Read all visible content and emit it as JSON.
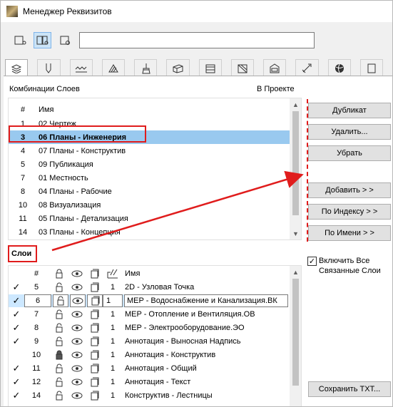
{
  "window": {
    "title": "Менеджер Реквизитов"
  },
  "toolbar": {
    "search_value": ""
  },
  "tabs": [
    {
      "icon": "layers-icon",
      "active": true
    },
    {
      "icon": "pen-icon"
    },
    {
      "icon": "line-type-icon"
    },
    {
      "icon": "fill-icon"
    },
    {
      "icon": "brush-icon"
    },
    {
      "icon": "building-material-icon"
    },
    {
      "icon": "composite-icon"
    },
    {
      "icon": "profile-icon"
    },
    {
      "icon": "zone-category-icon"
    },
    {
      "icon": "mep-icon"
    },
    {
      "icon": "globe-icon"
    },
    {
      "icon": "more-icon"
    }
  ],
  "combinations": {
    "header": "Комбинации Слоев",
    "in_project": "В Проекте",
    "col_num": "#",
    "col_name": "Имя",
    "rows": [
      {
        "num": "1",
        "name": "02 Чертеж"
      },
      {
        "num": "3",
        "name": "06 Планы - Инженерия",
        "selected": true
      },
      {
        "num": "4",
        "name": "07 Планы - Конструктив"
      },
      {
        "num": "5",
        "name": "09 Публикация"
      },
      {
        "num": "7",
        "name": "01 Местность"
      },
      {
        "num": "8",
        "name": "04 Планы - Рабочие"
      },
      {
        "num": "10",
        "name": "08 Визуализация"
      },
      {
        "num": "11",
        "name": "05 Планы - Детализация"
      },
      {
        "num": "14",
        "name": "03 Планы - Концепция"
      }
    ]
  },
  "buttons": {
    "duplicate": "Дубликат",
    "delete": "Удалить...",
    "remove": "Убрать",
    "add": "Добавить > >",
    "by_index": "По Индексу > >",
    "by_name": "По Имени > >",
    "save_txt": "Сохранить TXT..."
  },
  "layers": {
    "header": "Слои",
    "col_num": "#",
    "col_name": "Имя",
    "include_linked": "Включить Все Связанные Слои",
    "include_linked_checked": true,
    "rows": [
      {
        "check": "✓",
        "num": "5",
        "pen": "1",
        "name": "2D - Узловая Точка"
      },
      {
        "check": "✓",
        "num": "6",
        "pen": "1",
        "name": "MEP - Водоснабжение и Канализация.ВК",
        "selected": true
      },
      {
        "check": "✓",
        "num": "7",
        "pen": "1",
        "name": "MEP - Отопление и Вентиляция.ОВ"
      },
      {
        "check": "✓",
        "num": "8",
        "pen": "1",
        "name": "MEP - Электрооборудование.ЭО"
      },
      {
        "check": "✓",
        "num": "9",
        "pen": "1",
        "name": "Аннотация - Выносная Надпись"
      },
      {
        "check": "",
        "num": "10",
        "pen": "1",
        "name": "Аннотация - Конструктив",
        "locked": true
      },
      {
        "check": "✓",
        "num": "11",
        "pen": "1",
        "name": "Аннотация - Общий"
      },
      {
        "check": "✓",
        "num": "12",
        "pen": "1",
        "name": "Аннотация - Текст"
      },
      {
        "check": "✓",
        "num": "14",
        "pen": "1",
        "name": "Конструктив - Лестницы"
      }
    ]
  },
  "colors": {
    "accent_red": "#e01c1c",
    "selection": "#99c9ef"
  }
}
